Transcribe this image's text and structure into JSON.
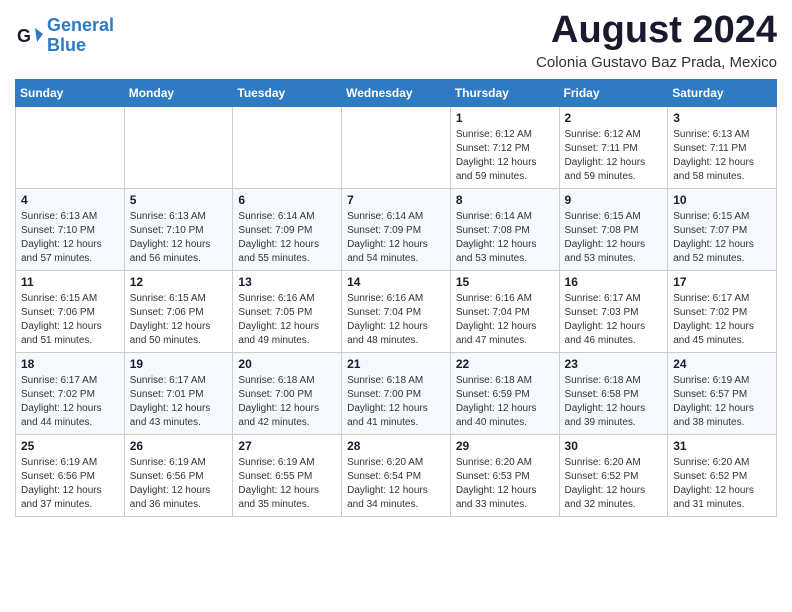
{
  "header": {
    "logo_line1": "General",
    "logo_line2": "Blue",
    "month_year": "August 2024",
    "location": "Colonia Gustavo Baz Prada, Mexico"
  },
  "weekdays": [
    "Sunday",
    "Monday",
    "Tuesday",
    "Wednesday",
    "Thursday",
    "Friday",
    "Saturday"
  ],
  "weeks": [
    [
      {
        "day": "",
        "info": ""
      },
      {
        "day": "",
        "info": ""
      },
      {
        "day": "",
        "info": ""
      },
      {
        "day": "",
        "info": ""
      },
      {
        "day": "1",
        "info": "Sunrise: 6:12 AM\nSunset: 7:12 PM\nDaylight: 12 hours\nand 59 minutes."
      },
      {
        "day": "2",
        "info": "Sunrise: 6:12 AM\nSunset: 7:11 PM\nDaylight: 12 hours\nand 59 minutes."
      },
      {
        "day": "3",
        "info": "Sunrise: 6:13 AM\nSunset: 7:11 PM\nDaylight: 12 hours\nand 58 minutes."
      }
    ],
    [
      {
        "day": "4",
        "info": "Sunrise: 6:13 AM\nSunset: 7:10 PM\nDaylight: 12 hours\nand 57 minutes."
      },
      {
        "day": "5",
        "info": "Sunrise: 6:13 AM\nSunset: 7:10 PM\nDaylight: 12 hours\nand 56 minutes."
      },
      {
        "day": "6",
        "info": "Sunrise: 6:14 AM\nSunset: 7:09 PM\nDaylight: 12 hours\nand 55 minutes."
      },
      {
        "day": "7",
        "info": "Sunrise: 6:14 AM\nSunset: 7:09 PM\nDaylight: 12 hours\nand 54 minutes."
      },
      {
        "day": "8",
        "info": "Sunrise: 6:14 AM\nSunset: 7:08 PM\nDaylight: 12 hours\nand 53 minutes."
      },
      {
        "day": "9",
        "info": "Sunrise: 6:15 AM\nSunset: 7:08 PM\nDaylight: 12 hours\nand 53 minutes."
      },
      {
        "day": "10",
        "info": "Sunrise: 6:15 AM\nSunset: 7:07 PM\nDaylight: 12 hours\nand 52 minutes."
      }
    ],
    [
      {
        "day": "11",
        "info": "Sunrise: 6:15 AM\nSunset: 7:06 PM\nDaylight: 12 hours\nand 51 minutes."
      },
      {
        "day": "12",
        "info": "Sunrise: 6:15 AM\nSunset: 7:06 PM\nDaylight: 12 hours\nand 50 minutes."
      },
      {
        "day": "13",
        "info": "Sunrise: 6:16 AM\nSunset: 7:05 PM\nDaylight: 12 hours\nand 49 minutes."
      },
      {
        "day": "14",
        "info": "Sunrise: 6:16 AM\nSunset: 7:04 PM\nDaylight: 12 hours\nand 48 minutes."
      },
      {
        "day": "15",
        "info": "Sunrise: 6:16 AM\nSunset: 7:04 PM\nDaylight: 12 hours\nand 47 minutes."
      },
      {
        "day": "16",
        "info": "Sunrise: 6:17 AM\nSunset: 7:03 PM\nDaylight: 12 hours\nand 46 minutes."
      },
      {
        "day": "17",
        "info": "Sunrise: 6:17 AM\nSunset: 7:02 PM\nDaylight: 12 hours\nand 45 minutes."
      }
    ],
    [
      {
        "day": "18",
        "info": "Sunrise: 6:17 AM\nSunset: 7:02 PM\nDaylight: 12 hours\nand 44 minutes."
      },
      {
        "day": "19",
        "info": "Sunrise: 6:17 AM\nSunset: 7:01 PM\nDaylight: 12 hours\nand 43 minutes."
      },
      {
        "day": "20",
        "info": "Sunrise: 6:18 AM\nSunset: 7:00 PM\nDaylight: 12 hours\nand 42 minutes."
      },
      {
        "day": "21",
        "info": "Sunrise: 6:18 AM\nSunset: 7:00 PM\nDaylight: 12 hours\nand 41 minutes."
      },
      {
        "day": "22",
        "info": "Sunrise: 6:18 AM\nSunset: 6:59 PM\nDaylight: 12 hours\nand 40 minutes."
      },
      {
        "day": "23",
        "info": "Sunrise: 6:18 AM\nSunset: 6:58 PM\nDaylight: 12 hours\nand 39 minutes."
      },
      {
        "day": "24",
        "info": "Sunrise: 6:19 AM\nSunset: 6:57 PM\nDaylight: 12 hours\nand 38 minutes."
      }
    ],
    [
      {
        "day": "25",
        "info": "Sunrise: 6:19 AM\nSunset: 6:56 PM\nDaylight: 12 hours\nand 37 minutes."
      },
      {
        "day": "26",
        "info": "Sunrise: 6:19 AM\nSunset: 6:56 PM\nDaylight: 12 hours\nand 36 minutes."
      },
      {
        "day": "27",
        "info": "Sunrise: 6:19 AM\nSunset: 6:55 PM\nDaylight: 12 hours\nand 35 minutes."
      },
      {
        "day": "28",
        "info": "Sunrise: 6:20 AM\nSunset: 6:54 PM\nDaylight: 12 hours\nand 34 minutes."
      },
      {
        "day": "29",
        "info": "Sunrise: 6:20 AM\nSunset: 6:53 PM\nDaylight: 12 hours\nand 33 minutes."
      },
      {
        "day": "30",
        "info": "Sunrise: 6:20 AM\nSunset: 6:52 PM\nDaylight: 12 hours\nand 32 minutes."
      },
      {
        "day": "31",
        "info": "Sunrise: 6:20 AM\nSunset: 6:52 PM\nDaylight: 12 hours\nand 31 minutes."
      }
    ]
  ]
}
